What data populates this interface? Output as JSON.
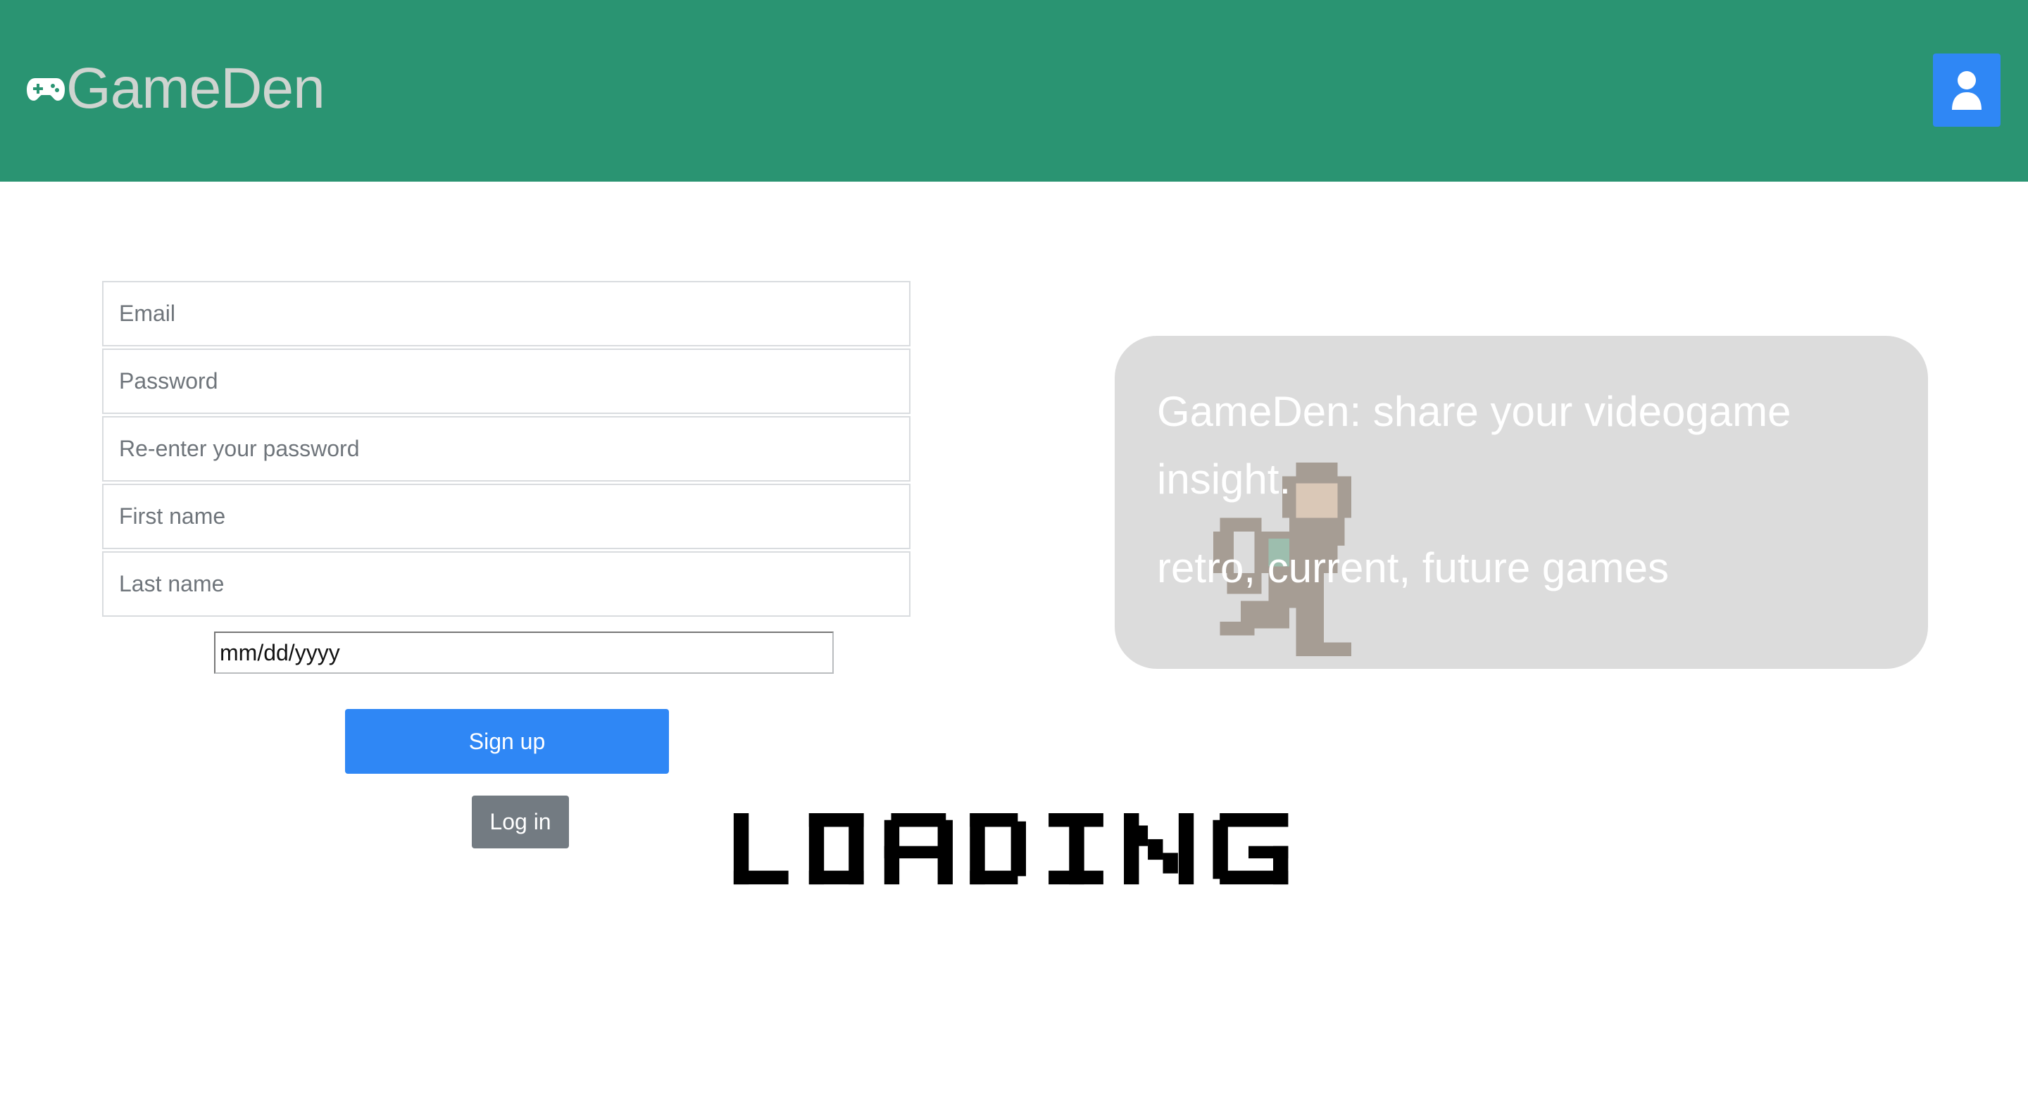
{
  "header": {
    "brand": "GameDen",
    "brand_icon": "gamepad-icon",
    "user_icon": "user-icon",
    "background_color": "#2a9472",
    "accent_color": "#2f87f5"
  },
  "form": {
    "email_placeholder": "Email",
    "password_placeholder": "Password",
    "reenter_password_placeholder": "Re-enter your password",
    "first_name_placeholder": "First name",
    "last_name_placeholder": "Last name",
    "birthdate_placeholder": "mm/dd/yyyy",
    "signup_label": "Sign up",
    "login_label": "Log in"
  },
  "loading_text": "LOADING",
  "hero": {
    "title": "GameDen: share your videogame insight.",
    "subtitle": "retro, current, future games"
  }
}
